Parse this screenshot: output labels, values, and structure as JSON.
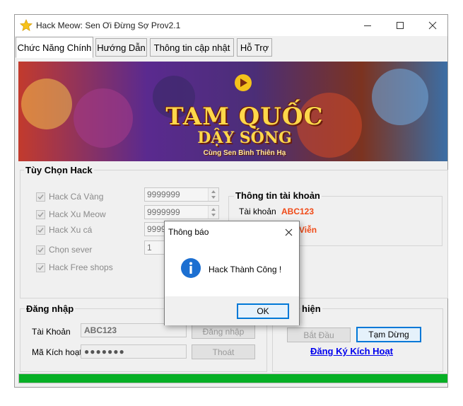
{
  "window": {
    "title": "Hack Meow: Sen Ơi Đừng Sợ  Prov2.1",
    "accent": "#0078d7"
  },
  "tabs": [
    {
      "label": "Chức Năng Chính",
      "active": true
    },
    {
      "label": "Hướng Dẫn",
      "active": false
    },
    {
      "label": "Thông tin cập nhật",
      "active": false
    },
    {
      "label": "Hỗ Trợ",
      "active": false
    }
  ],
  "banner": {
    "title_line1": "TAM QUỐC",
    "title_line2": "DẬY SÓNG",
    "subtitle": "Cùng Sen Bình Thiên Hạ"
  },
  "hack_options": {
    "title": "Tùy Chọn Hack",
    "items": [
      {
        "label": "Hack Cá Vàng",
        "checked": true,
        "value": "9999999"
      },
      {
        "label": "Hack Xu Meow",
        "checked": true,
        "value": "9999999"
      },
      {
        "label": "Hack Xu cá",
        "checked": true,
        "value": "9999"
      },
      {
        "label": "Chọn sever",
        "checked": true,
        "value": "1"
      },
      {
        "label": "Hack Free shops",
        "checked": true,
        "value": ""
      }
    ]
  },
  "account_info": {
    "title": "Thông tin tài khoản",
    "label": "Tài khoản",
    "value": "ABC123",
    "second_value": "Viễn"
  },
  "login": {
    "title": "Đăng nhập",
    "account_label": "Tài Khoản",
    "account_value": "ABC123",
    "code_label": "Mã Kích hoạt",
    "code_value": "●●●●●●●",
    "login_button": "Đăng nhập",
    "logout_button": "Thoát"
  },
  "execute": {
    "title_visible": "hiện",
    "start_button": "Bắt Đầu",
    "pause_button": "Tạm Dừng",
    "register_link": "Đăng Ký Kích Hoạt"
  },
  "progress": {
    "value": 100,
    "color": "#06b025"
  },
  "dialog": {
    "title": "Thông báo",
    "message": "Hack Thành Công !",
    "ok_button": "OK",
    "icon": "info-icon"
  }
}
